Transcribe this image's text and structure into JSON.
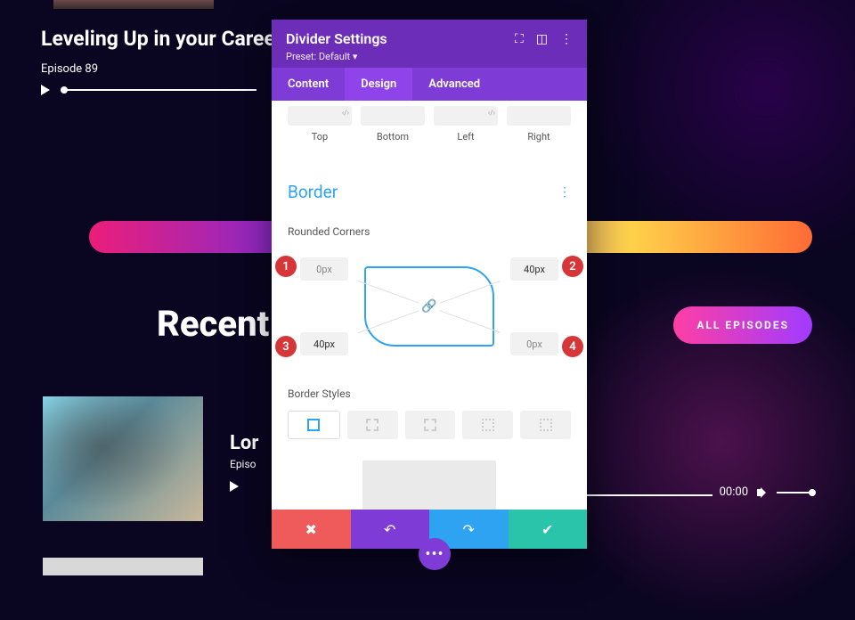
{
  "hero": {
    "title": "Leveling Up in your Career, w",
    "subtitle": "Episode 89"
  },
  "recent_heading": "Recent",
  "all_episodes_btn": "ALL EPISODES",
  "episode1": {
    "title": "Lor",
    "subtitle": "Episo",
    "time": "00:00"
  },
  "modal": {
    "title": "Divider Settings",
    "preset": "Preset: Default ▾",
    "tabs": {
      "content": "Content",
      "design": "Design",
      "advanced": "Advanced"
    },
    "spacing": {
      "top": "Top",
      "bottom": "Bottom",
      "left": "Left",
      "right": "Right"
    },
    "section_border": "Border",
    "rounded_label": "Rounded Corners",
    "corners": {
      "tl": "0px",
      "tr": "40px",
      "bl": "40px",
      "br": "0px"
    },
    "markers": {
      "m1": "1",
      "m2": "2",
      "m3": "3",
      "m4": "4"
    },
    "border_styles_label": "Border Styles"
  },
  "fab_label": "•••"
}
